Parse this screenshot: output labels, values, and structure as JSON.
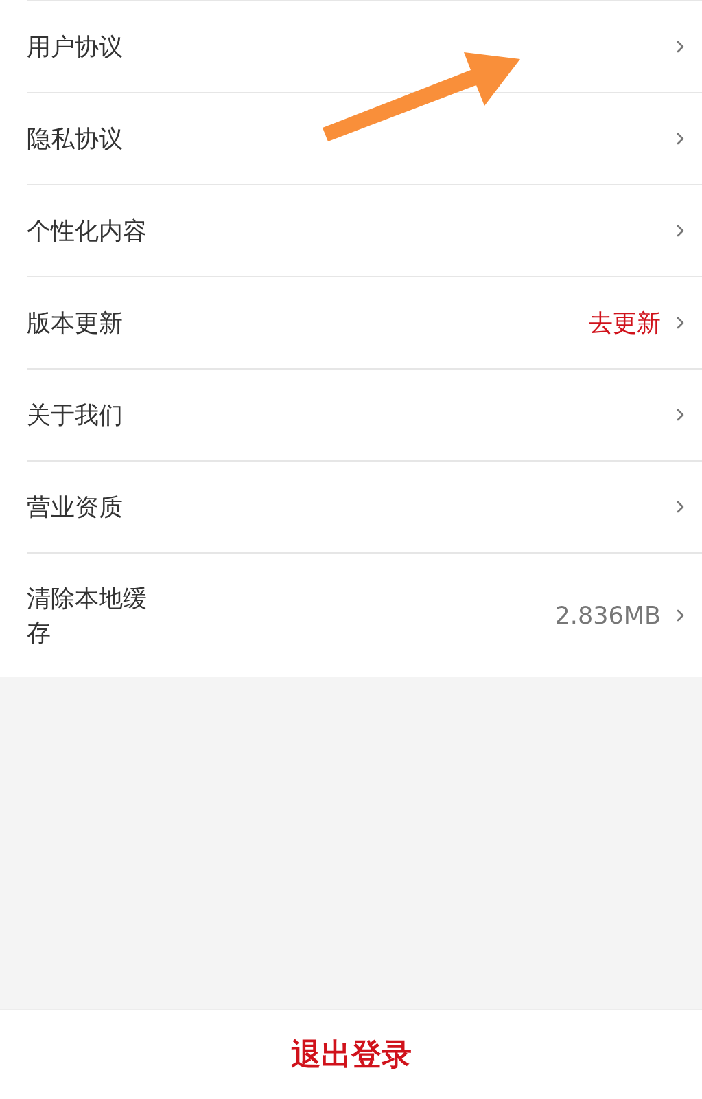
{
  "settings": [
    {
      "kind": "plain",
      "label": "用户协议"
    },
    {
      "kind": "plain",
      "label": "隐私协议"
    },
    {
      "kind": "plain",
      "label": "个性化内容"
    },
    {
      "kind": "action",
      "label": "版本更新",
      "value": "去更新"
    },
    {
      "kind": "plain",
      "label": "关于我们"
    },
    {
      "kind": "plain",
      "label": "营业资质"
    },
    {
      "kind": "info",
      "label": "清除本地缓存",
      "value": "2.836MB"
    }
  ],
  "annotation": {
    "kind": "arrow"
  },
  "logout_button": "退出登录"
}
